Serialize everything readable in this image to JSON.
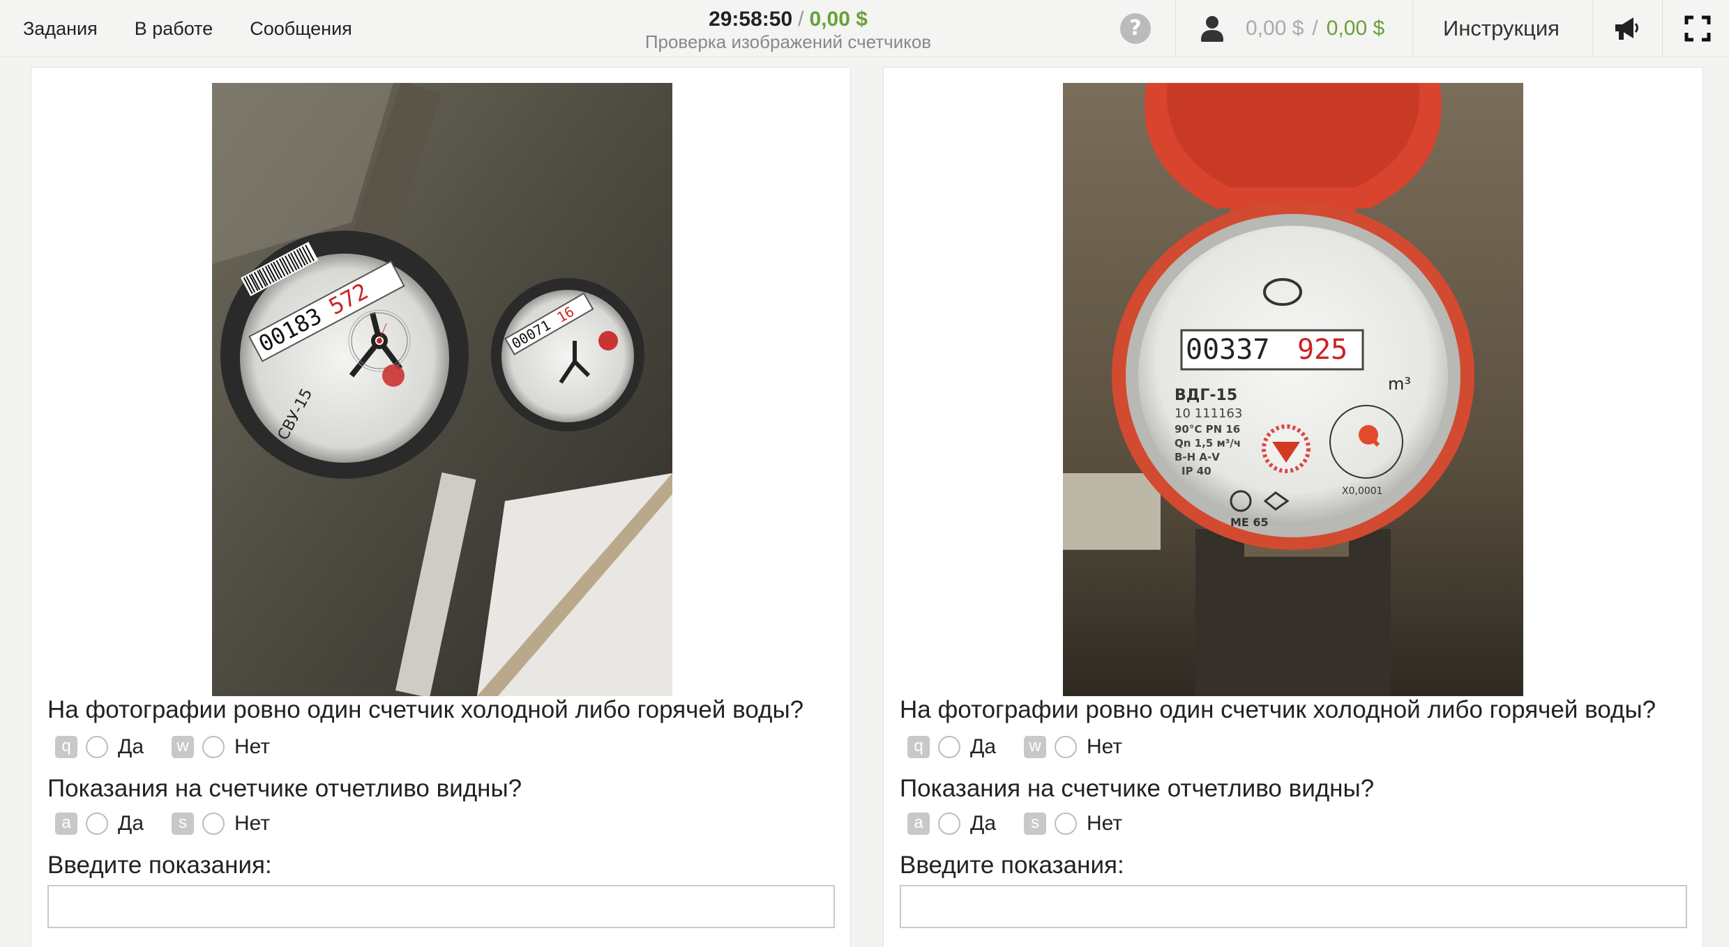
{
  "nav": {
    "tasks": "Задания",
    "in_progress": "В работе",
    "messages": "Сообщения"
  },
  "header": {
    "timer": "29:58:50",
    "separator": "/",
    "earnings": "0,00 $",
    "project_title": "Проверка изображений счетчиков",
    "help_symbol": "?",
    "balance_pending": "0,00 $",
    "balance_available": "0,00 $",
    "instructions_label": "Инструкция",
    "icons": [
      "question-icon",
      "user-icon",
      "megaphone-icon",
      "fullscreen-icon"
    ]
  },
  "colors": {
    "accent_green": "#6aa03a",
    "hotkey_bg": "#c8c8c8"
  },
  "tasks": [
    {
      "q1": "На фотографии ровно один счетчик холодной либо горячей воды?",
      "q1_yes_key": "q",
      "q1_no_key": "w",
      "q2": "Показания на счетчике отчетливо видны?",
      "q2_yes_key": "a",
      "q2_no_key": "s",
      "yes": "Да",
      "no": "Нет",
      "q3": "Введите показания:",
      "reading_value": "",
      "photo": {
        "meter_1_reading": "00183572",
        "meter_1_model": "СВУ-15"
      }
    },
    {
      "q1": "На фотографии ровно один счетчик холодной либо горячей воды?",
      "q1_yes_key": "q",
      "q1_no_key": "w",
      "q2": "Показания на счетчике отчетливо видны?",
      "q2_yes_key": "a",
      "q2_no_key": "s",
      "yes": "Да",
      "no": "Нет",
      "q3": "Введите показания:",
      "reading_value": "",
      "photo": {
        "reading_black": "00337",
        "reading_red": "925",
        "model": "ВДГ-15",
        "serial": "10 111163",
        "spec1": "90°C PN 16",
        "spec2": "Qn 1,5 м³/ч",
        "spec3": "В-Н А-V",
        "spec4": "IP 40",
        "unit": "m³",
        "mark": "МЕ 65",
        "factor": "X0,0001"
      }
    }
  ]
}
